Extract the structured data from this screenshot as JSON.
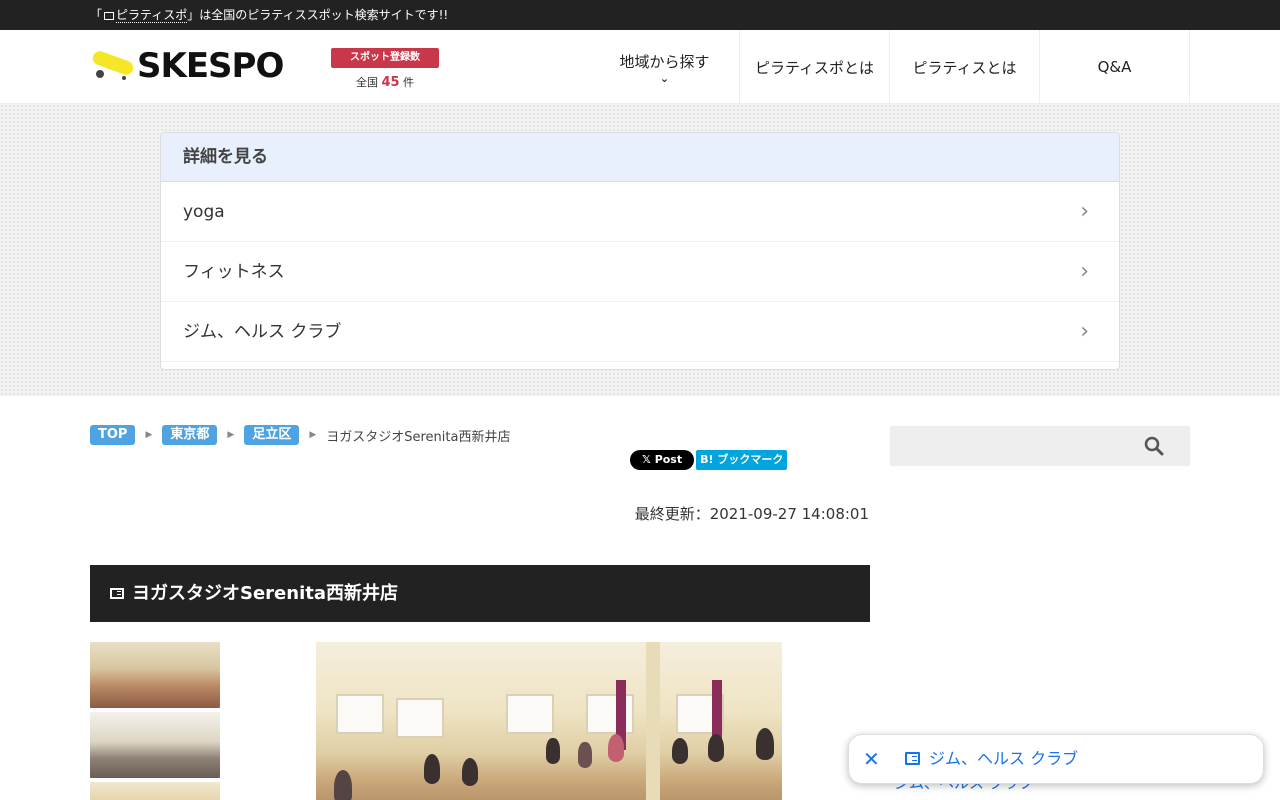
{
  "topbar": {
    "open_quote": "「",
    "brand": "ピラティスポ",
    "message": "」は全国のピラティススポット検索サイトです!!"
  },
  "logo": {
    "text": "SKESPO",
    "ribbon": "スポット登録数",
    "count_prefix": "全国",
    "count": "45",
    "count_suffix": "件"
  },
  "nav": {
    "items": [
      {
        "label": "地域から探す",
        "chevron": "⌄"
      },
      {
        "label": "ピラティスポとは"
      },
      {
        "label": "ピラティスとは"
      },
      {
        "label": "Q&A"
      }
    ]
  },
  "details": {
    "heading": "詳細を見る",
    "items": [
      {
        "label": "yoga"
      },
      {
        "label": "フィットネス"
      },
      {
        "label": "ジム、ヘルス クラブ"
      }
    ],
    "arrow": "›"
  },
  "breadcrumb": {
    "items": [
      "TOP",
      "東京都",
      "足立区"
    ],
    "separator": "▶",
    "current": "ヨガスタジオSerenita西新井店"
  },
  "share": {
    "x_label": "𝕏 Post",
    "hatena_label": "B! ブックマーク"
  },
  "updated": {
    "label": "最終更新：2021-09-27 14:08:01"
  },
  "post": {
    "title": "ヨガスタジオSerenita西新井店"
  },
  "search": {
    "placeholder": ""
  },
  "toast": {
    "close": "✕",
    "label": "ジム、ヘルス クラブ"
  },
  "under_toast": {
    "label": "ジム、ヘルス クラブ"
  },
  "colors": {
    "topbar": "#222222",
    "crumb_tag": "#4fa3e0",
    "detail_header": "#e8f0fd",
    "logo_ribbon": "#c8384a",
    "link_blue": "#1a73e8",
    "hatena_blue": "#00a4de"
  }
}
